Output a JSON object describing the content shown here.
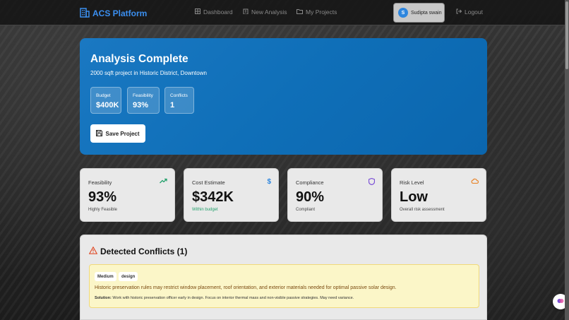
{
  "nav": {
    "brand": "ACS Platform",
    "links": [
      {
        "label": "Dashboard",
        "icon": "grid-icon"
      },
      {
        "label": "New Analysis",
        "icon": "building-icon"
      },
      {
        "label": "My Projects",
        "icon": "folder-icon"
      }
    ],
    "user": {
      "initial": "S",
      "name": "Sudipta swain"
    },
    "logout": "Logout"
  },
  "hero": {
    "title": "Analysis Complete",
    "subtitle": "2000 sqft project in Historic District, Downtown",
    "stats": [
      {
        "label": "Budget",
        "value": "$400K"
      },
      {
        "label": "Feasibility",
        "value": "93%"
      },
      {
        "label": "Conflicts",
        "value": "1"
      }
    ],
    "save_label": "Save Project"
  },
  "cards": [
    {
      "title": "Feasibility",
      "value": "93%",
      "note": "Highly Feasible",
      "icon": "trending-up-icon",
      "icon_color": "#22a06b"
    },
    {
      "title": "Cost Estimate",
      "value": "$342K",
      "note": "Within budget",
      "icon": "dollar-icon",
      "icon_color": "#2e86de",
      "note_color": "#22a06b"
    },
    {
      "title": "Compliance",
      "value": "90%",
      "note": "Compliant",
      "icon": "shield-icon",
      "icon_color": "#7b4fd6"
    },
    {
      "title": "Risk Level",
      "value": "Low",
      "note": "Overall risk assessment",
      "icon": "cloud-icon",
      "icon_color": "#e8862d"
    }
  ],
  "conflicts": {
    "heading": "Detected Conflicts (1)",
    "items": [
      {
        "tags": [
          "Medium",
          "design"
        ],
        "description": "Historic preservation rules may restrict window placement, roof orientation, and exterior materials needed for optimal passive solar design.",
        "solution_label": "Solution:",
        "solution": "Work with historic preservation officer early in design. Focus on interior thermal mass and non-visible passive strategies. May need variance."
      }
    ]
  },
  "colors": {
    "brand": "#3b8ff0",
    "hero": "#0f6fb8",
    "warning_bg": "#fbf6c8"
  }
}
